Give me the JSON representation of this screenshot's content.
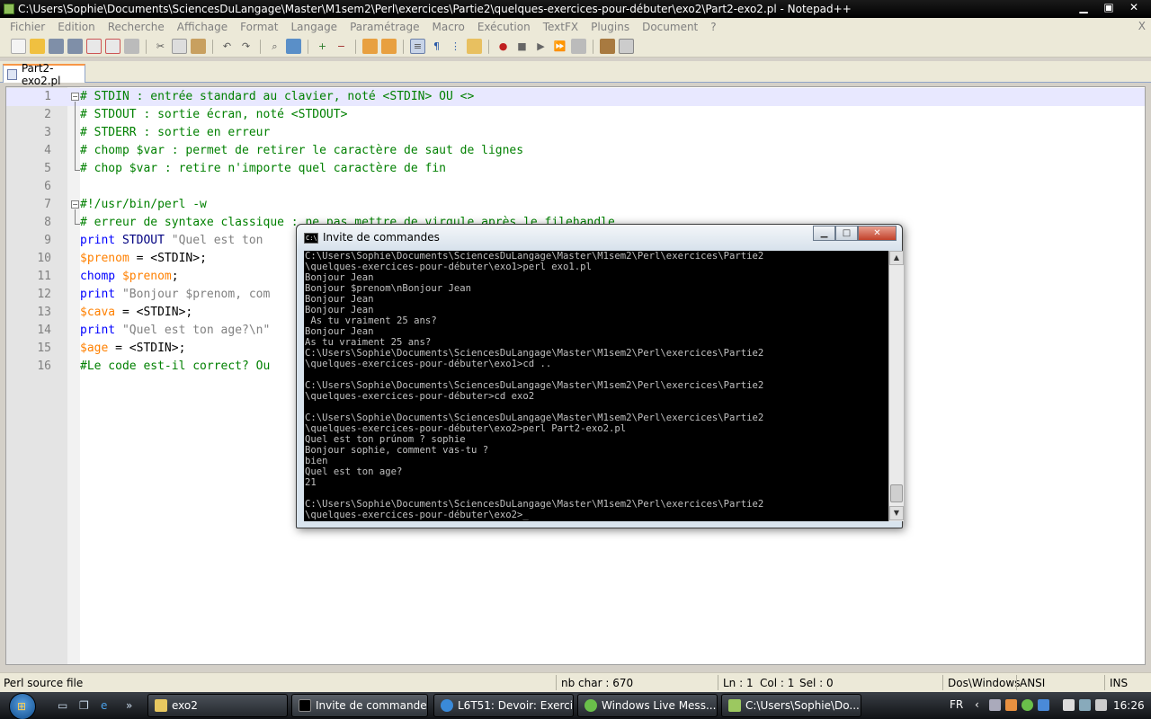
{
  "window": {
    "title": "C:\\Users\\Sophie\\Documents\\SciencesDuLangage\\Master\\M1sem2\\Perl\\exercices\\Partie2\\quelques-exercices-pour-débuter\\exo2\\Part2-exo2.pl - Notepad++",
    "minimize": "▁",
    "maximize": "▣",
    "close": "✕"
  },
  "menu": {
    "items": [
      "Fichier",
      "Edition",
      "Recherche",
      "Affichage",
      "Format",
      "Langage",
      "Paramétrage",
      "Macro",
      "Exécution",
      "TextFX",
      "Plugins",
      "Document",
      "?"
    ],
    "close_x": "X"
  },
  "tab": {
    "label": "Part2-exo2.pl"
  },
  "editor": {
    "lines": [
      {
        "n": "1",
        "text": "# STDIN : entrée standard au clavier, noté <STDIN> OU <>"
      },
      {
        "n": "2",
        "text": "# STDOUT : sortie écran, noté <STDOUT>"
      },
      {
        "n": "3",
        "text": "# STDERR : sortie en erreur"
      },
      {
        "n": "4",
        "text": "# chomp $var : permet de retirer le caractère de saut de lignes"
      },
      {
        "n": "5",
        "text": "# chop $var : retire n'importe quel caractère de fin"
      },
      {
        "n": "6",
        "text": ""
      },
      {
        "n": "7",
        "text": "#!/usr/bin/perl -w"
      },
      {
        "n": "8",
        "text": "# erreur de syntaxe classique : ne pas mettre de virgule après le filehandle"
      },
      {
        "n": "9",
        "kw": "print",
        "rest": " STDOUT ",
        "str": "\"Quel est ton"
      },
      {
        "n": "10",
        "var": "$prenom",
        "rest": " = <STDIN>;"
      },
      {
        "n": "11",
        "kw": "chomp",
        "rest": " ",
        "var": "$prenom",
        "rest2": ";"
      },
      {
        "n": "12",
        "kw": "print",
        "rest": " ",
        "str": "\"Bonjour $prenom, com"
      },
      {
        "n": "13",
        "var": "$cava",
        "rest": " = <STDIN>;"
      },
      {
        "n": "14",
        "kw": "print",
        "rest": " ",
        "str": "\"Quel est ton age?\\n\""
      },
      {
        "n": "15",
        "var": "$age",
        "rest": " = <STDIN>;"
      },
      {
        "n": "16",
        "text": "#Le code est-il correct? Ou"
      }
    ]
  },
  "console": {
    "title": "Invite de commandes",
    "output": "C:\\Users\\Sophie\\Documents\\SciencesDuLangage\\Master\\M1sem2\\Perl\\exercices\\Partie2\n\\quelques-exercices-pour-débuter\\exo1>perl exo1.pl\nBonjour Jean\nBonjour $prenom\\nBonjour Jean\nBonjour Jean\nBonjour Jean\n As tu vraiment 25 ans?\nBonjour Jean\nAs tu vraiment 25 ans?\nC:\\Users\\Sophie\\Documents\\SciencesDuLangage\\Master\\M1sem2\\Perl\\exercices\\Partie2\n\\quelques-exercices-pour-débuter\\exo1>cd ..\n\nC:\\Users\\Sophie\\Documents\\SciencesDuLangage\\Master\\M1sem2\\Perl\\exercices\\Partie2\n\\quelques-exercices-pour-débuter>cd exo2\n\nC:\\Users\\Sophie\\Documents\\SciencesDuLangage\\Master\\M1sem2\\Perl\\exercices\\Partie2\n\\quelques-exercices-pour-débuter\\exo2>perl Part2-exo2.pl\nQuel est ton prúnom ? sophie\nBonjour sophie, comment vas-tu ?\nbien\nQuel est ton age?\n21\n\nC:\\Users\\Sophie\\Documents\\SciencesDuLangage\\Master\\M1sem2\\Perl\\exercices\\Partie2\n\\quelques-exercices-pour-débuter\\exo2>_"
  },
  "status": {
    "file_type": "Perl source file",
    "nb_char": "nb char : 670",
    "ln": "Ln : 1",
    "col": "Col : 1",
    "sel": "Sel : 0",
    "eol": "Dos\\Windows",
    "encoding": "ANSI",
    "mode": "INS"
  },
  "taskbar": {
    "tasks": [
      {
        "label": "exo2",
        "icon": "folder-icon"
      },
      {
        "label": "Invite de commandes",
        "icon": "cmd-icon"
      },
      {
        "label": "L6T51: Devoir: Exerci...",
        "icon": "ie-icon"
      },
      {
        "label": "Windows Live Mess...",
        "icon": "messenger-icon"
      },
      {
        "label": "C:\\Users\\Sophie\\Do...",
        "icon": "notepadpp-icon"
      }
    ],
    "lang": "FR",
    "clock": "16:26",
    "more": "»",
    "tray_arrow": "‹"
  }
}
